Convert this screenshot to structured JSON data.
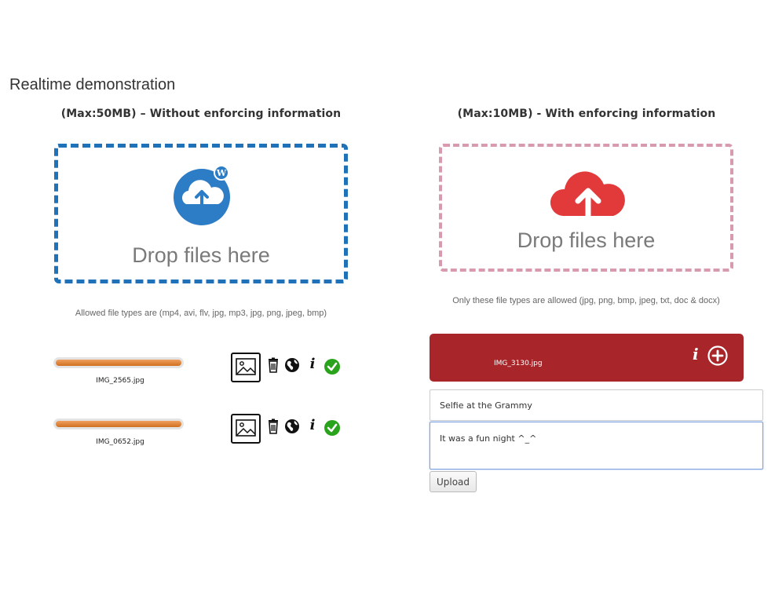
{
  "page": {
    "title": "Realtime demonstration"
  },
  "left": {
    "heading": "(Max:50MB) – Without enforcing information",
    "drop_text": "Drop files here",
    "hint": "Allowed file types are (mp4, avi, flv, jpg, mp3, jpg, png, jpeg, bmp)",
    "icon": "cloud-upload-wordpress-icon",
    "accent_color": "#1f72b8",
    "files": [
      {
        "name": "IMG_2565.jpg",
        "progress": 1.0
      },
      {
        "name": "IMG_0652.jpg",
        "progress": 1.0
      }
    ]
  },
  "right": {
    "heading": "(Max:10MB) - With enforcing information",
    "drop_text": "Drop files here",
    "hint": "Only these file types are allowed (jpg, png, bmp, jpeg, txt, doc & docx)",
    "icon": "cloud-upload-icon",
    "accent_color": "#e23a3a",
    "file": {
      "name": "IMG_3130.jpg"
    },
    "form": {
      "title_value": "Selfie at the Grammy",
      "description_value": "It was a fun night ^_^",
      "upload_label": "Upload"
    }
  }
}
